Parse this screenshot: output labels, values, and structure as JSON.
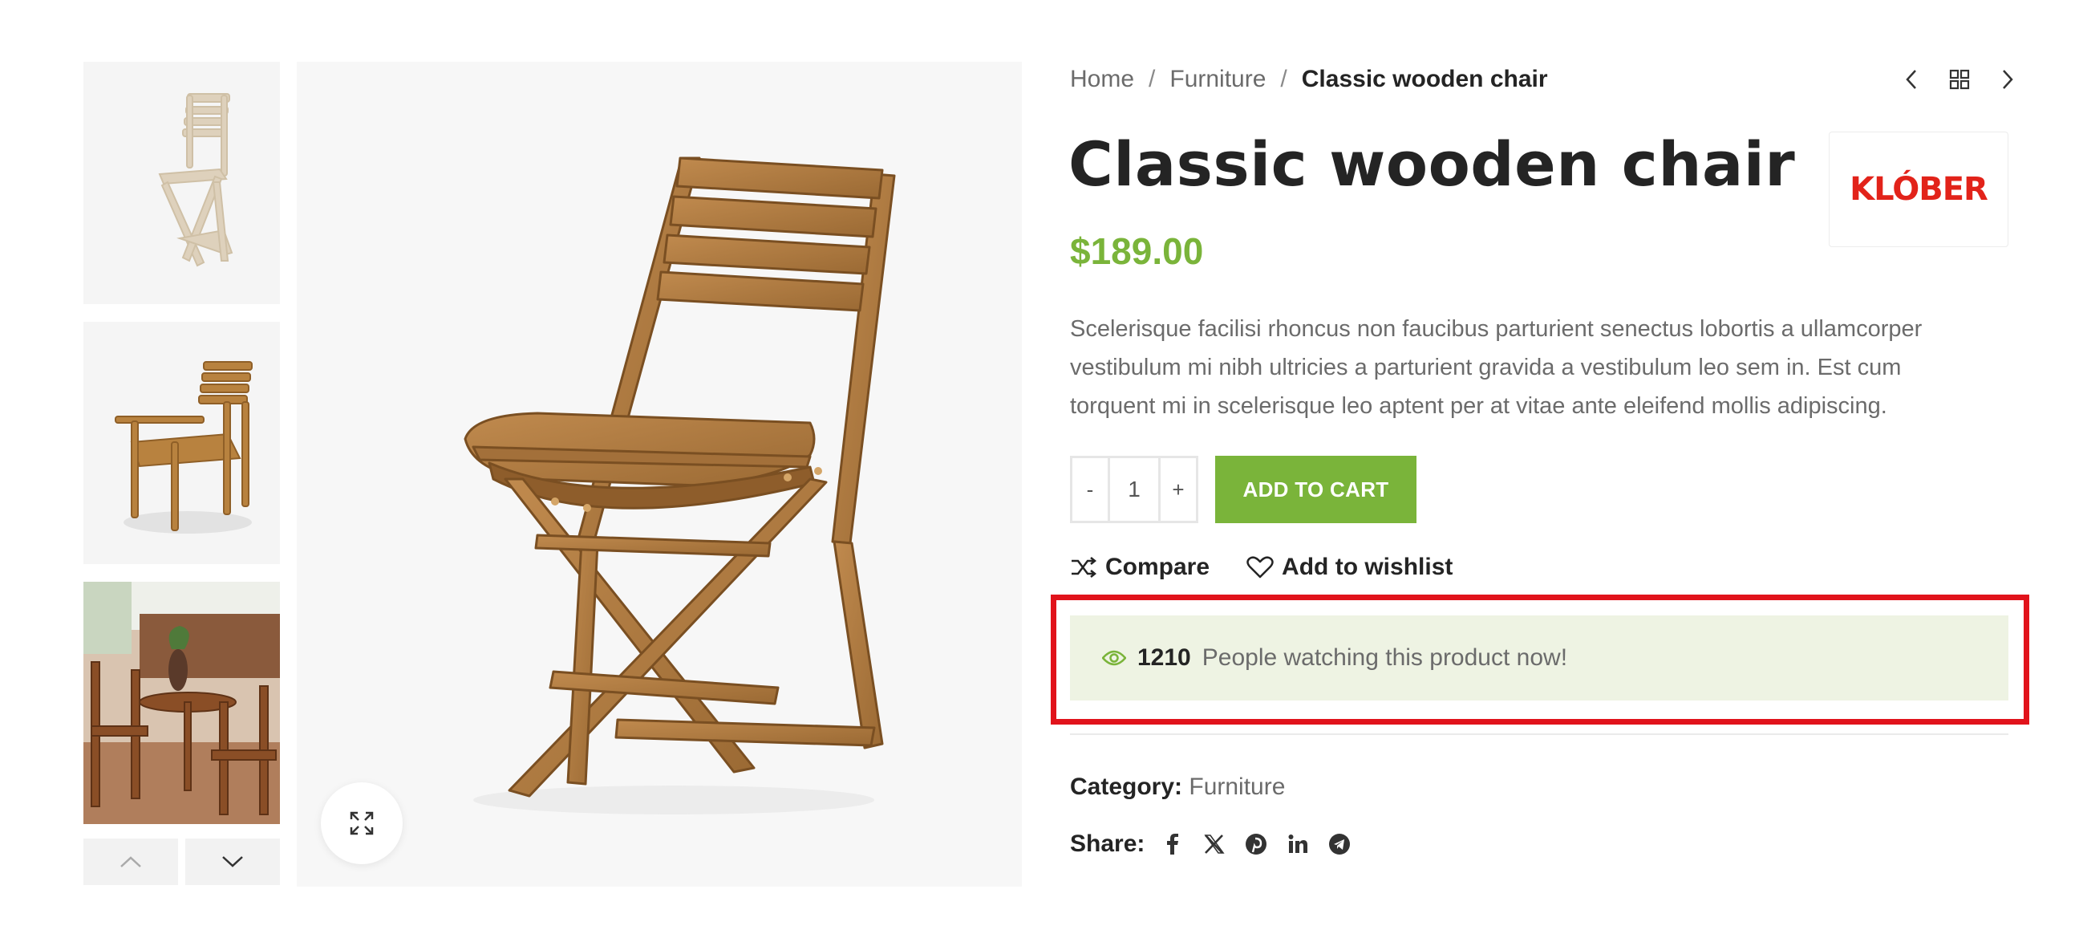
{
  "breadcrumb": {
    "home": "Home",
    "category": "Furniture",
    "current": "Classic wooden chair",
    "separator": "/"
  },
  "product": {
    "title": "Classic wooden chair",
    "price": "$189.00",
    "description": "Scelerisque facilisi rhoncus non faucibus parturient senectus lobortis a ullamcorper vestibulum mi nibh ultricies a parturient gravida a vestibulum leo sem in. Est cum torquent mi in scelerisque leo aptent per at vitae ante eleifend mollis adipiscing.",
    "brand": "KLÓBER"
  },
  "cart": {
    "minus": "-",
    "quantity": "1",
    "plus": "+",
    "add_label": "ADD TO CART"
  },
  "actions": {
    "compare": "Compare",
    "wishlist": "Add to wishlist"
  },
  "watching": {
    "count": "1210",
    "text": "People watching this product now!"
  },
  "meta": {
    "category_label": "Category:",
    "category_value": "Furniture",
    "share_label": "Share:"
  },
  "icons": {
    "share": [
      "facebook-icon",
      "x-icon",
      "pinterest-icon",
      "linkedin-icon",
      "telegram-icon"
    ],
    "nav": [
      "chevron-left-icon",
      "grid-icon",
      "chevron-right-icon"
    ]
  },
  "colors": {
    "accent": "#7ab43a",
    "watch_bg": "#eef3e3",
    "highlight": "#e1131b",
    "brand": "#e2231a"
  }
}
